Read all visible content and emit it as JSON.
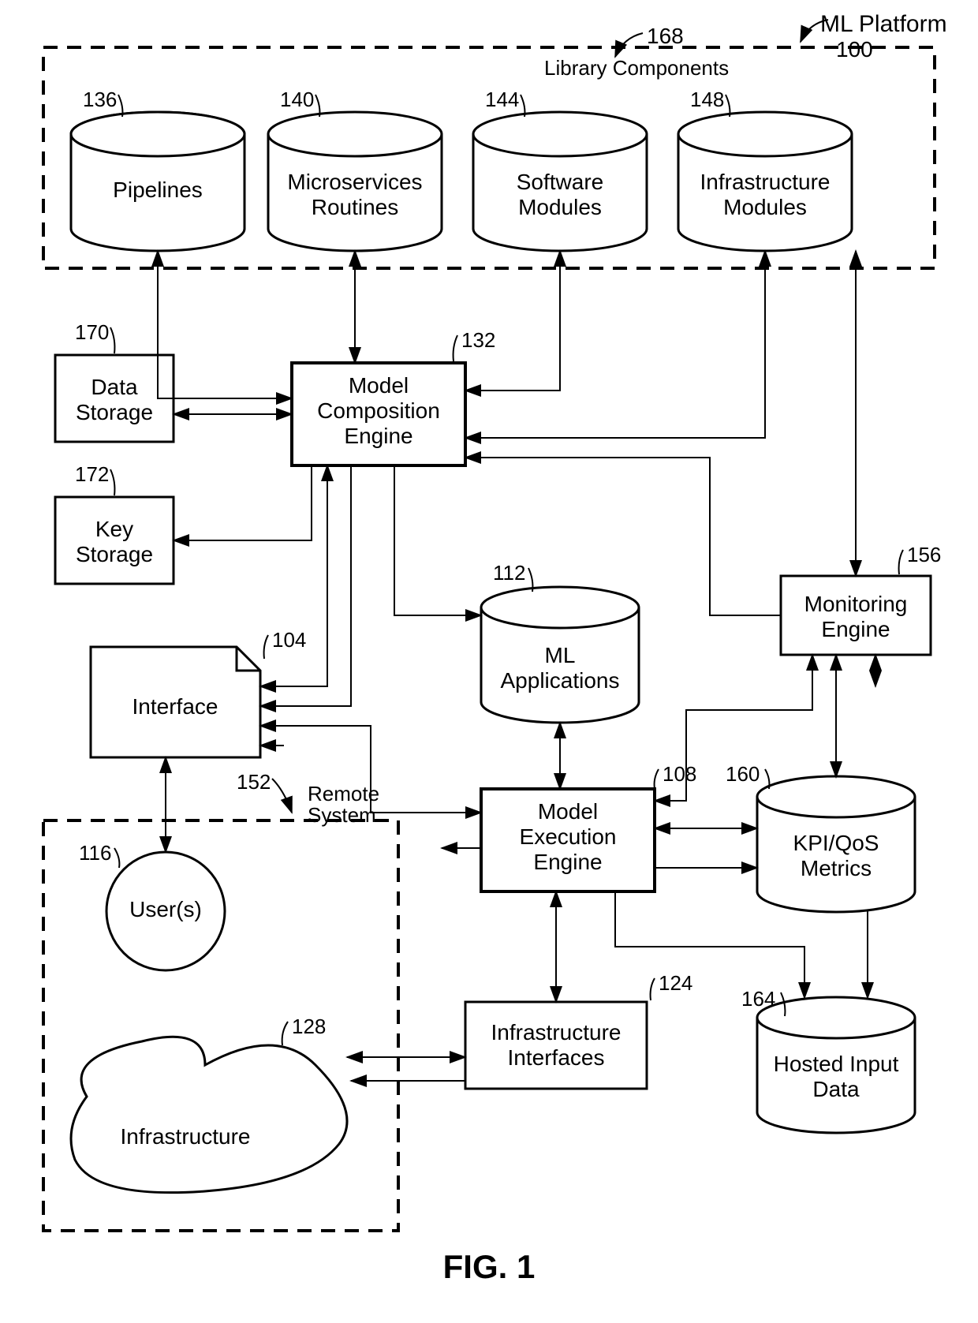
{
  "diagram": {
    "title_main": "ML Platform",
    "title_ref": "100",
    "library_label": "Library Components",
    "library_ref": "168",
    "cylinders": {
      "pipelines": {
        "label": "Pipelines",
        "ref": "136"
      },
      "microservices": {
        "label1": "Microservices",
        "label2": "Routines",
        "ref": "140"
      },
      "software_modules": {
        "label1": "Software",
        "label2": "Modules",
        "ref": "144"
      },
      "infra_modules": {
        "label1": "Infrastructure",
        "label2": "Modules",
        "ref": "148"
      },
      "ml_apps": {
        "label1": "ML",
        "label2": "Applications",
        "ref": "112"
      },
      "kpi": {
        "label1": "KPI/QoS",
        "label2": "Metrics",
        "ref": "160"
      },
      "hosted_input": {
        "label1": "Hosted Input",
        "label2": "Data",
        "ref": "164"
      }
    },
    "boxes": {
      "data_storage": {
        "label1": "Data",
        "label2": "Storage",
        "ref": "170"
      },
      "key_storage": {
        "label1": "Key",
        "label2": "Storage",
        "ref": "172"
      },
      "model_comp": {
        "label1": "Model",
        "label2": "Composition",
        "label3": "Engine",
        "ref": "132"
      },
      "interface": {
        "label": "Interface",
        "ref": "104"
      },
      "model_exec": {
        "label1": "Model",
        "label2": "Execution",
        "label3": "Engine",
        "ref": "108"
      },
      "monitoring": {
        "label1": "Monitoring",
        "label2": "Engine",
        "ref": "156"
      },
      "infra_ifaces": {
        "label1": "Infrastructure",
        "label2": "Interfaces",
        "ref": "124"
      }
    },
    "circle_user": {
      "label": "User(s)",
      "ref": "116"
    },
    "infra_blob": {
      "label": "Infrastructure",
      "ref": "128"
    },
    "remote_label1": "Remote",
    "remote_label2": "System",
    "remote_ref": "152",
    "figure_caption": "FIG. 1"
  }
}
